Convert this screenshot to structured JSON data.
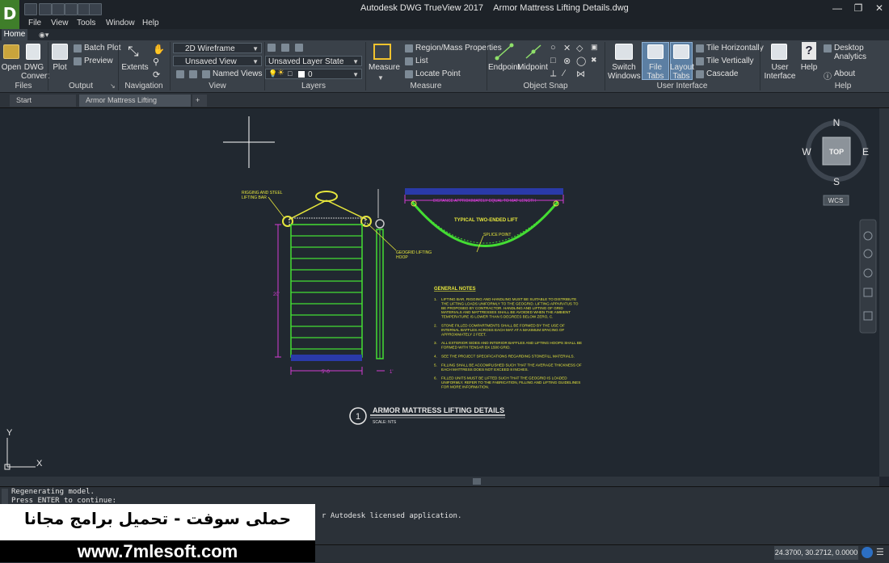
{
  "window": {
    "app_logo": "D",
    "title": "Autodesk DWG TrueView 2017",
    "document": "Armor Mattress Lifting Details.dwg"
  },
  "menu": [
    "File",
    "View",
    "Tools",
    "Window",
    "Help"
  ],
  "ribbon_tab": "Home",
  "ribbon": {
    "files": {
      "open": "Open",
      "dwg_convert_1": "DWG",
      "dwg_convert_2": "Convert",
      "title": "Files"
    },
    "output": {
      "plot": "Plot",
      "batch_plot": "Batch Plot",
      "preview": "Preview",
      "title": "Output"
    },
    "navigation": {
      "extents": "Extents",
      "title": "Navigation"
    },
    "view": {
      "visual_style": "2D Wireframe",
      "view_combo": "Unsaved View",
      "named_views": "Named Views",
      "title": "View"
    },
    "layers": {
      "layer_state": "Unsaved Layer State",
      "current_layer": "0",
      "title": "Layers"
    },
    "measure": {
      "measure": "Measure",
      "region_mass": "Region/Mass Properties",
      "list": "List",
      "locate_point": "Locate Point",
      "title": "Measure"
    },
    "object_snap": {
      "endpoint": "Endpoint",
      "midpoint": "Midpoint",
      "title": "Object Snap"
    },
    "user_interface": {
      "switch_windows_1": "Switch",
      "switch_windows_2": "Windows",
      "file_tabs": "File Tabs",
      "layout_tabs_1": "Layout",
      "layout_tabs_2": "Tabs",
      "tile_h": "Tile Horizontally",
      "tile_v": "Tile Vertically",
      "cascade": "Cascade",
      "title": "User Interface"
    },
    "help": {
      "ui_1": "User",
      "ui_2": "Interface",
      "help": "Help",
      "desktop_analytics": "Desktop Analytics",
      "about": "About",
      "title": "Help"
    }
  },
  "doc_tabs": [
    "Start",
    "Armor Mattress Lifting Details"
  ],
  "viewcube": {
    "n": "N",
    "s": "S",
    "e": "E",
    "w": "W",
    "top": "TOP",
    "wcs": "WCS"
  },
  "drawing": {
    "label_rigging": "RIGGING AND STEEL",
    "label_rigging_2": "LIFTING BAR",
    "label_geogrid": "GEOGRID LIFTING",
    "label_geogrid_2": "HOOP",
    "label_distance": "DISTANCE APPROXIMATELY EQUAL TO MAT LENGTH",
    "label_typical": "TYPICAL TWO-ENDED LIFT",
    "label_splice": "SPLICE POINT",
    "dim_height": "20'",
    "dim_width": "5'-0",
    "dim_thick": "1'",
    "notes_title": "GENERAL NOTES",
    "notes": [
      {
        "num": "1.",
        "lines": [
          "LIFTING BAR, RIGGING AND HANDLING MUST BE SUITABLE TO DISTRIBUTE",
          "THE LIFTING LOADS UNIFORMLY TO THE GEOGRID. LIFTING APPARATUS TO",
          "BE PROPOSED BY CONTRACTOR. HANDLING AND LIFTING OF GRID",
          "MATERIALS AND MATTRESSES SHALL BE AVOIDED WHEN THE AMBIENT",
          "TEMPERATURE IS LOWER THAN 5 DEGREES BELOW ZERO, C."
        ]
      },
      {
        "num": "2.",
        "lines": [
          "STONE FILLED COMPARTMENTS SHALL BE FORMED BY THE USE OF",
          "INTERNAL BAFFLES ACROSS EACH MAT AT A MAXIMUM SPACING OF",
          "APPROXIMATELY 2 FEET."
        ]
      },
      {
        "num": "3.",
        "lines": [
          "ALL EXTERIOR SIDES AND INTERIOR BAFFLES AND LIFTING HOOPS SHALL BE",
          "FORMED WITH TENSAR BX 1500 GRID."
        ]
      },
      {
        "num": "4.",
        "lines": [
          "SEE THE PROJECT SPECIFICATIONS REGARDING STONEFILL MATERIALS."
        ]
      },
      {
        "num": "5.",
        "lines": [
          "FILLING SHALL BE ACCOMPLISHED SUCH THAT THE AVERAGE THICKNESS OF",
          "EACH MATTRESS DOES NOT EXCEED 8 INCHES."
        ]
      },
      {
        "num": "6.",
        "lines": [
          "FILLED UNITS MUST BE LIFTED SUCH THAT THE GEOGRID IS LOADED",
          "UNIFORMLY. REFER TO THE FABRICATION, FILLING AND LIFTING GUIDELINES",
          "FOR MORE INFORMATION."
        ]
      }
    ],
    "detail_number": "1",
    "detail_title": "ARMOR MATTRESS LIFTING DETAILS",
    "detail_scale": "SCALE: NTS",
    "ucs_x": "X",
    "ucs_y": "Y"
  },
  "command": {
    "line1": "Regenerating model.",
    "line2": "Press ENTER to continue:",
    "line3": "r Autodesk licensed application."
  },
  "status": {
    "coords": "24.3700, 30.2712, 0.0000"
  },
  "watermark": {
    "arabic": "حملى سوفت - تحميل برامج مجانا",
    "url": "www.7mlesoft.com"
  },
  "colors": {
    "drawing_bg": "#212830",
    "green": "#44dd33",
    "yellow": "#e6e63c",
    "magenta": "#d23cd2",
    "blue": "#2a3aa8"
  }
}
